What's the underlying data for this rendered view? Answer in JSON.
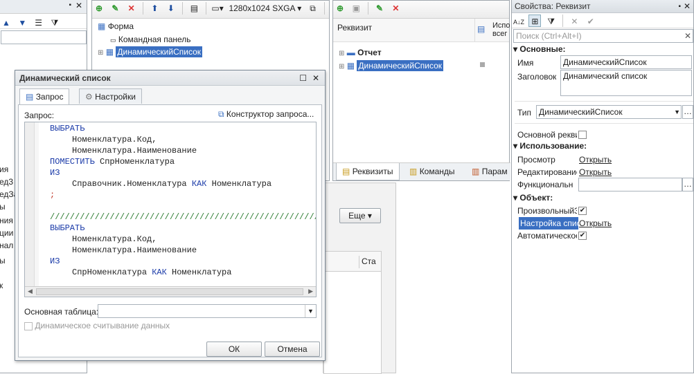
{
  "left_partial": {
    "lines": [
      "ия",
      "ед3",
      "едЗа",
      "ы",
      "ния",
      "ции",
      "нал",
      "ы",
      "к"
    ]
  },
  "form_tree": {
    "items": [
      {
        "label": "Форма"
      },
      {
        "label": "Командная панель"
      },
      {
        "label": "ДинамическийСписок"
      }
    ],
    "resolution": "1280x1024 SXGA"
  },
  "attributes_panel": {
    "col_header": "Реквизит",
    "col_header2": "Испо всег",
    "rows": [
      {
        "label": "Отчет"
      },
      {
        "label": "ДинамическийСписок"
      }
    ],
    "tabs": [
      "Реквизиты",
      "Команды",
      "Парам"
    ]
  },
  "background_form": {
    "more_button": "Еще",
    "col_header": "Ста"
  },
  "dialog": {
    "title": "Динамический список",
    "tabs": [
      "Запрос",
      "Настройки"
    ],
    "query_label": "Запрос:",
    "constructor_link": "Конструктор запроса...",
    "code_lines": [
      {
        "indent": 0,
        "parts": [
          {
            "t": "ВЫБРАТЬ",
            "c": "kw"
          }
        ]
      },
      {
        "indent": 1,
        "parts": [
          {
            "t": "Номенклатура.Код,",
            "c": ""
          }
        ]
      },
      {
        "indent": 1,
        "parts": [
          {
            "t": "Номенклатура.Наименование",
            "c": ""
          }
        ]
      },
      {
        "indent": 0,
        "parts": [
          {
            "t": "ПОМЕСТИТЬ",
            "c": "kw"
          },
          {
            "t": " СпрНоменклатура",
            "c": ""
          }
        ]
      },
      {
        "indent": 0,
        "parts": [
          {
            "t": "ИЗ",
            "c": "kw"
          }
        ]
      },
      {
        "indent": 1,
        "parts": [
          {
            "t": "Справочник.Номенклатура ",
            "c": ""
          },
          {
            "t": "КАК",
            "c": "kw"
          },
          {
            "t": " Номенклатура",
            "c": ""
          }
        ]
      },
      {
        "indent": 0,
        "parts": [
          {
            "t": ";",
            "c": "red"
          }
        ]
      },
      {
        "indent": 0,
        "parts": [
          {
            "t": "",
            "c": ""
          }
        ]
      },
      {
        "indent": 0,
        "parts": [
          {
            "t": "//////////////////////////////////////////////////////",
            "c": "comment"
          }
        ]
      },
      {
        "indent": 0,
        "parts": [
          {
            "t": "ВЫБРАТЬ",
            "c": "kw"
          }
        ]
      },
      {
        "indent": 1,
        "parts": [
          {
            "t": "Номенклатура.Код,",
            "c": ""
          }
        ]
      },
      {
        "indent": 1,
        "parts": [
          {
            "t": "Номенклатура.Наименование",
            "c": ""
          }
        ]
      },
      {
        "indent": 0,
        "parts": [
          {
            "t": "ИЗ",
            "c": "kw"
          }
        ]
      },
      {
        "indent": 1,
        "parts": [
          {
            "t": "СпрНоменклатура ",
            "c": ""
          },
          {
            "t": "КАК",
            "c": "kw"
          },
          {
            "t": " Номенклатура",
            "c": ""
          }
        ]
      }
    ],
    "main_table_label": "Основная таблица:",
    "main_table_value": "",
    "dynamic_read_label": "Динамическое считывание данных",
    "ok_label": "ОК",
    "cancel_label": "Отмена"
  },
  "properties": {
    "title": "Свойства: Реквизит",
    "search_placeholder": "Поиск (Ctrl+Alt+I)",
    "section_basic": "Основные:",
    "name_label": "Имя",
    "name_value": "ДинамическийСписок",
    "title_label": "Заголовок",
    "title_value": "Динамический список",
    "type_label": "Тип",
    "type_value": "ДинамическийСписок",
    "main_attr_label": "Основной рекви",
    "section_usage": "Использование:",
    "view_label": "Просмотр",
    "view_link": "Открыть",
    "edit_label": "Редактирование",
    "edit_link": "Открыть",
    "func_label": "Функциональн",
    "section_object": "Объект:",
    "custom_label": "ПроизвольныйЗ",
    "settings_label": "Настройка спис",
    "settings_link": "Открыть",
    "auto_label": "Автоматическое"
  }
}
